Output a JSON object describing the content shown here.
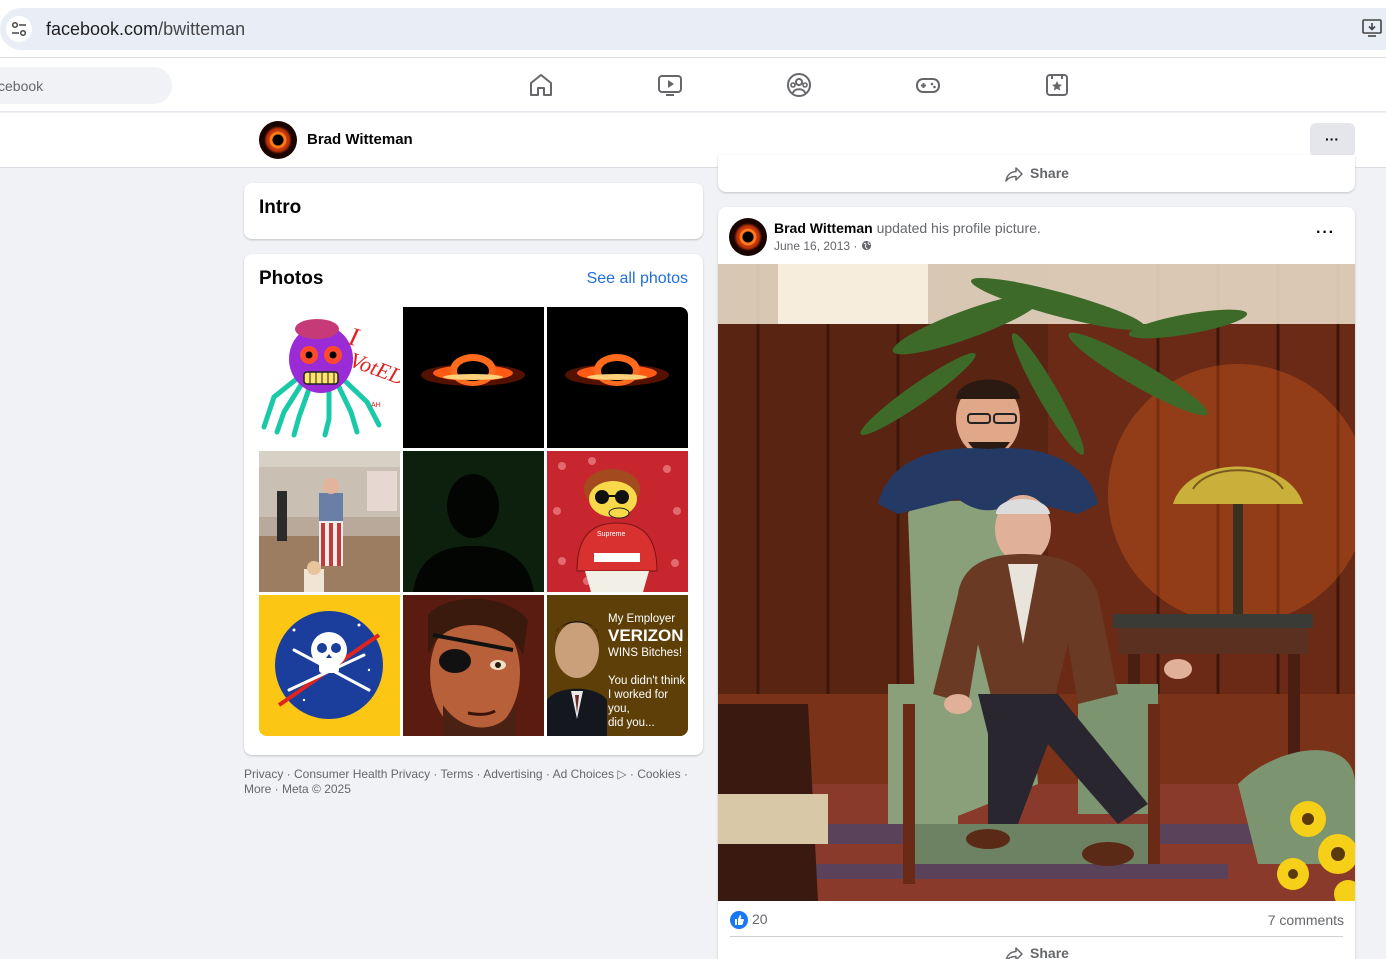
{
  "browser": {
    "url_domain": "facebook.com",
    "url_path": "/bwitteman"
  },
  "nav": {
    "search_placeholder": "Search Facebook",
    "search_visible_text": "cebook",
    "icons": [
      "home-icon",
      "video-icon",
      "groups-icon",
      "gaming-icon",
      "feeds-icon"
    ]
  },
  "profile_header": {
    "name": "Brad Witteman",
    "more_label": "···"
  },
  "intro": {
    "title": "Intro"
  },
  "photos": {
    "title": "Photos",
    "see_all": "See all photos",
    "items": [
      {
        "name": "photo-i-voted-spider",
        "caption": "I VOTED"
      },
      {
        "name": "photo-black-hole-1",
        "caption": ""
      },
      {
        "name": "photo-black-hole-2",
        "caption": ""
      },
      {
        "name": "photo-man-stars-stripes-pants",
        "caption": ""
      },
      {
        "name": "photo-silhouette",
        "caption": ""
      },
      {
        "name": "photo-cartoon-supreme",
        "caption": "Supreme"
      },
      {
        "name": "photo-pirate-nasa-logo",
        "caption": ""
      },
      {
        "name": "photo-eyepatch-portrait",
        "caption": ""
      },
      {
        "name": "photo-verizon-meme",
        "caption_lines": [
          "My Employer",
          "VERIZON",
          "WINS Bitches!",
          "You didn't think",
          "I worked for you,",
          "did you..."
        ]
      }
    ]
  },
  "footer": {
    "links": [
      "Privacy",
      "Consumer Health Privacy",
      "Terms",
      "Advertising",
      "Ad Choices",
      "Cookies",
      "More"
    ],
    "copyright": "Meta © 2025"
  },
  "prev_post": {
    "share_label": "Share"
  },
  "post": {
    "author": "Brad Witteman",
    "action": "updated his profile picture.",
    "date": "June 16, 2013",
    "privacy": "Public",
    "more_label": "···",
    "like_count": "20",
    "comments": "7 comments",
    "share_label": "Share"
  },
  "colors": {
    "link_blue": "#216fdb",
    "like_blue": "#1877f2",
    "page_bg": "#f0f2f5"
  }
}
